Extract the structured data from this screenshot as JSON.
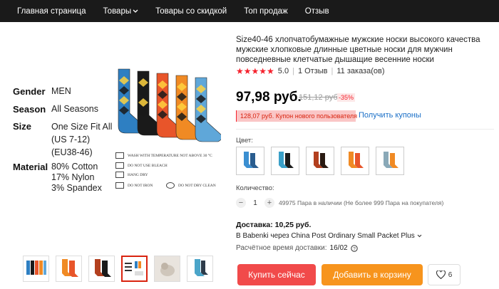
{
  "nav": {
    "items": [
      "Главная страница",
      "Товары",
      "Товары со скидкой",
      "Топ продаж",
      "Отзыв"
    ]
  },
  "gallery": {
    "specs": [
      {
        "key": "Gender",
        "value": "MEN"
      },
      {
        "key": "Season",
        "value": "All Seasons"
      },
      {
        "key": "Size",
        "value": "One Size Fit All"
      },
      {
        "key": "",
        "value": "(US  7-12)"
      },
      {
        "key": "",
        "value": "(EU38-46)"
      },
      {
        "key": "Material",
        "value": "80% Cotton"
      },
      {
        "key": "",
        "value": "17% Nylon"
      },
      {
        "key": "",
        "value": "3%  Spandex"
      }
    ],
    "care": [
      "WASH WITH TEMPERATURE NOT ABOVE 30 °C",
      "DO NOT USE BLEACH",
      "HANG DRY",
      "DO NOT IRON",
      "DO NOT DRY CLEAN"
    ],
    "sock_colors": [
      "#2e7fc2",
      "#1a1a1a",
      "#e8552a",
      "#f08a24",
      "#5fa7d9"
    ]
  },
  "thumbs": {
    "colors": [
      "#3b6fb0",
      "#f08a24",
      "#b3401f",
      "#ffffff",
      "#d9d3cc",
      "#4ba5c9"
    ]
  },
  "product": {
    "title": "Size40-46 хлопчатобумажные мужские носки высокого качества мужские хлопковые длинные цветные носки для мужчин повседневные клетчатые дышащие весенние носки",
    "rating_value": "5.0",
    "reviews": "1 Отзыв",
    "orders": "11 заказа(ов)",
    "price": "97,98 руб.",
    "old_price": "151,12 руб.",
    "discount": "-35%",
    "coupon": "128,07 руб. Купон нового пользователя",
    "coupon_link": "Получить купоны",
    "color_label": "Цвет:",
    "quantity_label": "Количество:",
    "quantity": "1",
    "stock_info": "49975 Пара в наличии (Не более 999 Пара на покупателя)",
    "shipping_title": "Доставка: 10,25 руб.",
    "shipping_line": "В Babenki через China Post Ordinary Small Packet Plus",
    "delivery_label": "Расчётное время доставки:",
    "delivery_date": "16/02",
    "buy_label": "Купить сейчас",
    "cart_label": "Добавить в корзину",
    "wish_count": "6"
  },
  "colors": {
    "accent": "#f14a4a",
    "cart": "#f7941d",
    "link": "#1a6fc7",
    "nav_bg": "#1a1a1a"
  }
}
